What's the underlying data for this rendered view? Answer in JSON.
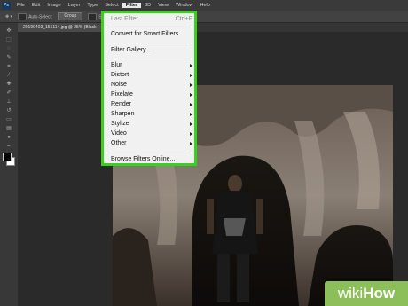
{
  "menubar": {
    "logo": "Ps",
    "items": [
      "File",
      "Edit",
      "Image",
      "Layer",
      "Type",
      "Select",
      "Filter",
      "3D",
      "View",
      "Window",
      "Help"
    ],
    "active_index": 6
  },
  "options_bar": {
    "auto_select_label": "Auto-Select:",
    "group_value": "Group",
    "show_label": "Sho"
  },
  "document_tab": {
    "title": "20190403_155114.jpg @ 25% (Black"
  },
  "filter_menu": {
    "last_filter": "Last Filter",
    "last_filter_shortcut": "Ctrl+F",
    "convert_smart": "Convert for Smart Filters",
    "gallery": "Filter Gallery...",
    "submenus": [
      "Blur",
      "Distort",
      "Noise",
      "Pixelate",
      "Render",
      "Sharpen",
      "Stylize",
      "Video",
      "Other"
    ],
    "browse_online": "Browse Filters Online..."
  },
  "watermark": {
    "wiki": "wiki",
    "how": "How"
  },
  "colors": {
    "highlight_border": "#38d11c",
    "watermark_bg": "#8cbf5a",
    "app_bg": "#2b2b2b"
  }
}
